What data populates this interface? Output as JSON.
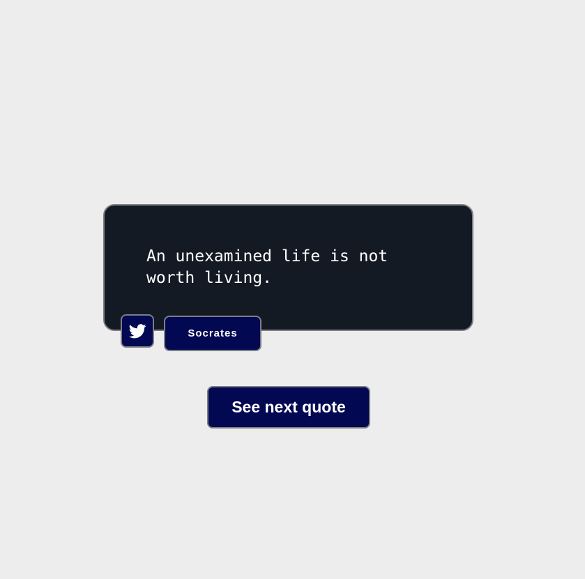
{
  "quote": {
    "text": "An unexamined life is not worth living.",
    "author": "Socrates"
  },
  "actions": {
    "tweet_icon": "twitter-icon",
    "next_label": "See next quote"
  },
  "colors": {
    "background": "#eeeded",
    "card": "#141a24",
    "button": "#020852",
    "border": "#7c7f86",
    "text": "#ffffff"
  }
}
